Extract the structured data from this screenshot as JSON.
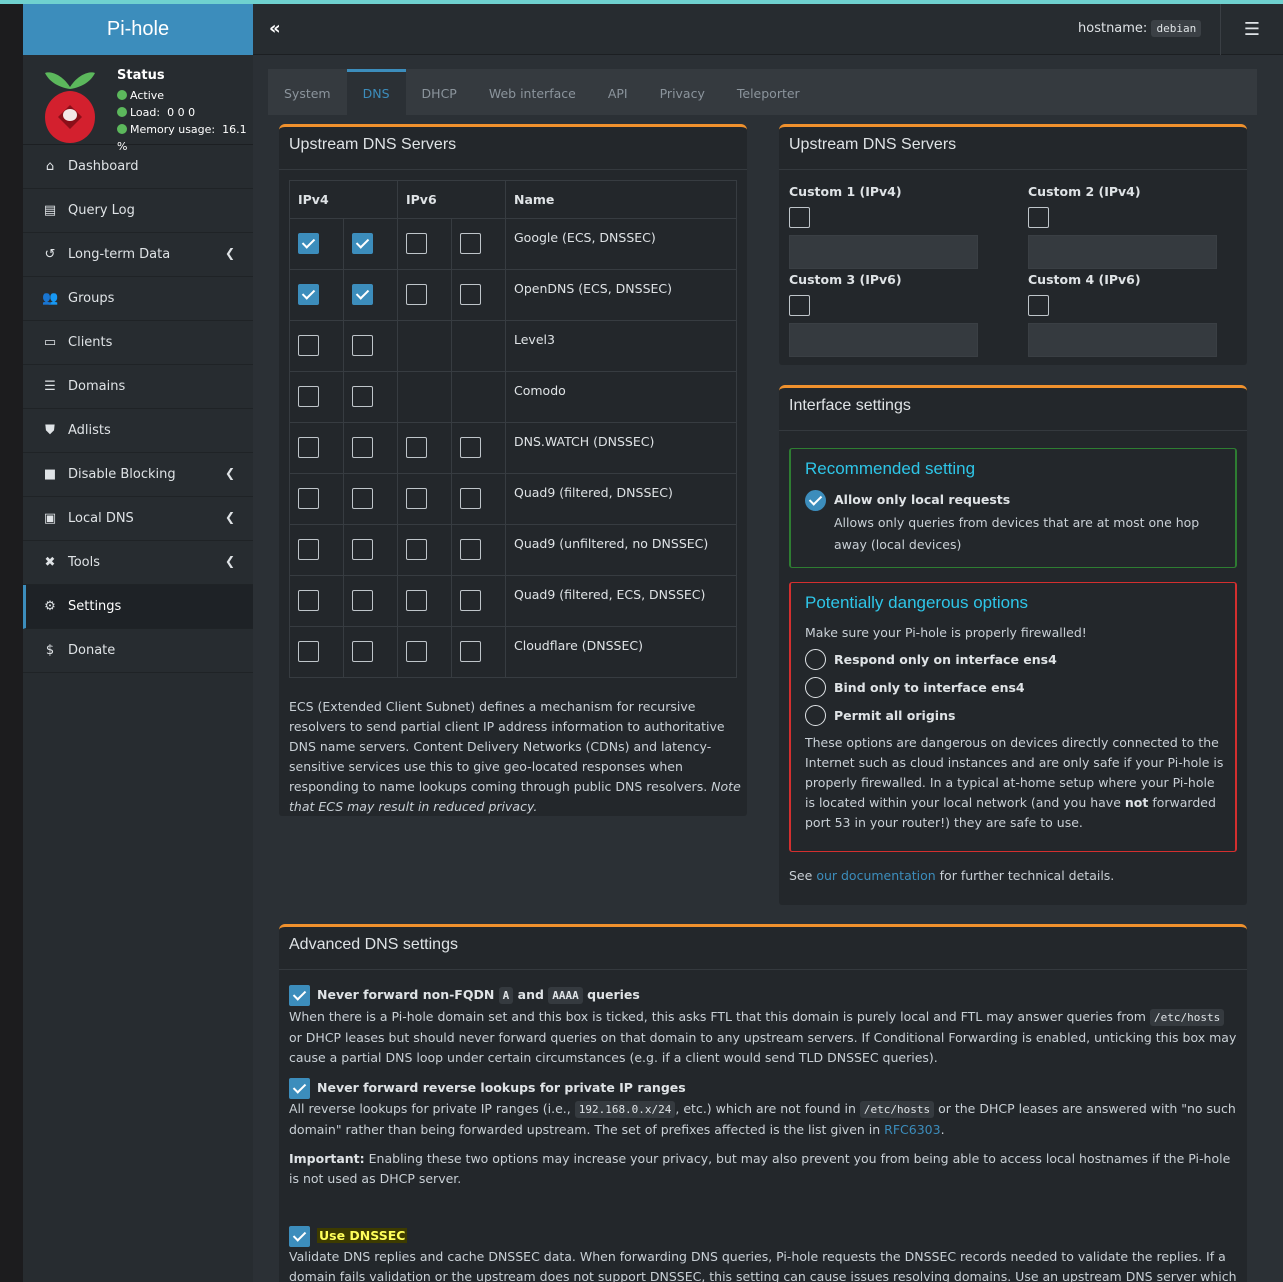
{
  "brand": "Pi-hole",
  "status": {
    "title": "Status",
    "active": "Active",
    "load_label": "Load:",
    "load_value": "0 0 0",
    "memory_label": "Memory usage:",
    "memory_value": "16.1 %"
  },
  "sidebar": {
    "items": [
      {
        "label": "Dashboard"
      },
      {
        "label": "Query Log"
      },
      {
        "label": "Long-term Data"
      },
      {
        "label": "Groups"
      },
      {
        "label": "Clients"
      },
      {
        "label": "Domains"
      },
      {
        "label": "Adlists"
      },
      {
        "label": "Disable Blocking"
      },
      {
        "label": "Local DNS"
      },
      {
        "label": "Tools"
      },
      {
        "label": "Settings"
      },
      {
        "label": "Donate"
      }
    ]
  },
  "topbar": {
    "hostname_label": "hostname:",
    "hostname_value": "debian"
  },
  "tabs": [
    "System",
    "DNS",
    "DHCP",
    "Web interface",
    "API",
    "Privacy",
    "Teleporter"
  ],
  "upstream": {
    "title": "Upstream DNS Servers",
    "col_ipv4": "IPv4",
    "col_ipv6": "IPv6",
    "col_name": "Name",
    "rows": [
      {
        "name": "Google (ECS, DNSSEC)"
      },
      {
        "name": "OpenDNS (ECS, DNSSEC)"
      },
      {
        "name": "Level3"
      },
      {
        "name": "Comodo"
      },
      {
        "name": "DNS.WATCH (DNSSEC)"
      },
      {
        "name": "Quad9 (filtered, DNSSEC)"
      },
      {
        "name": "Quad9 (unfiltered, no DNSSEC)"
      },
      {
        "name": "Quad9 (filtered, ECS, DNSSEC)"
      },
      {
        "name": "Cloudflare (DNSSEC)"
      }
    ],
    "ecs_text": "ECS (Extended Client Subnet) defines a mechanism for recursive resolvers to send partial client IP address information to authoritative DNS name servers. Content Delivery Networks (CDNs) and latency-sensitive services use this to give geo-located responses when responding to name lookups coming through public DNS resolvers.",
    "ecs_note": "Note that ECS may result in reduced privacy."
  },
  "custom": {
    "title": "Upstream DNS Servers",
    "c1": "Custom 1 (IPv4)",
    "c2": "Custom 2 (IPv4)",
    "c3": "Custom 3 (IPv6)",
    "c4": "Custom 4 (IPv6)"
  },
  "interface": {
    "title": "Interface settings",
    "recommended_title": "Recommended setting",
    "local_label": "Allow only local requests",
    "local_desc": "Allows only queries from devices that are at most one hop away (local devices)",
    "danger_title": "Potentially dangerous options",
    "danger_intro": "Make sure your Pi-hole is properly firewalled!",
    "opt1": "Respond only on interface ens4",
    "opt2": "Bind only to interface ens4",
    "opt3": "Permit all origins",
    "danger_text_1": "These options are dangerous on devices directly connected to the Internet such as cloud instances and are only safe if your Pi-hole is properly firewalled. In a typical at-home setup where your Pi-hole is located within your local network (and you have",
    "danger_not": "not",
    "danger_text_2": "forwarded port 53 in your router!) they are safe to use.",
    "see": "See",
    "doc_link": "our documentation",
    "further": "for further technical details."
  },
  "advanced": {
    "title": "Advanced DNS settings",
    "fqdn_label_1": "Never forward non-FQDN",
    "fqdn_code_a": "A",
    "fqdn_and": "and",
    "fqdn_code_aaaa": "AAAA",
    "fqdn_label_2": "queries",
    "fqdn_desc_1": "When there is a Pi-hole domain set and this box is ticked, this asks FTL that this domain is purely local and FTL may answer queries from",
    "fqdn_code_hosts": "/etc/hosts",
    "fqdn_desc_2": "or DHCP leases but should never forward queries on that domain to any upstream servers. If Conditional Forwarding is enabled, unticking this box may cause a partial DNS loop under certain circumstances (e.g. if a client would send TLD DNSSEC queries).",
    "rev_label": "Never forward reverse lookups for private IP ranges",
    "rev_desc_1": "All reverse lookups for private IP ranges (i.e.,",
    "rev_code_range": "192.168.0.x/24",
    "rev_desc_2": ", etc.) which are not found in",
    "rev_code_hosts": "/etc/hosts",
    "rev_desc_3": "or the DHCP leases are answered with \"no such domain\" rather than being forwarded upstream. The set of prefixes affected is the list given in",
    "rev_link": "RFC6303",
    "rev_desc_4": ".",
    "important_label": "Important:",
    "important_text": "Enabling these two options may increase your privacy, but may also prevent you from being able to access local hostnames if the Pi-hole is not used as DHCP server.",
    "dnssec_label": "Use DNSSEC",
    "dnssec_desc": "Validate DNS replies and cache DNSSEC data. When forwarding DNS queries, Pi-hole requests the DNSSEC records needed to validate the replies. If a domain fails validation or the upstream does not support DNSSEC, this setting can cause issues resolving domains. Use an upstream DNS server which supports DNSSEC when"
  },
  "colors": {
    "accent": "#3c8dbc",
    "box_border": "#f0912d",
    "success": "#5cb85c",
    "danger": "#d32f2f",
    "info_title": "#2ec6e8"
  }
}
